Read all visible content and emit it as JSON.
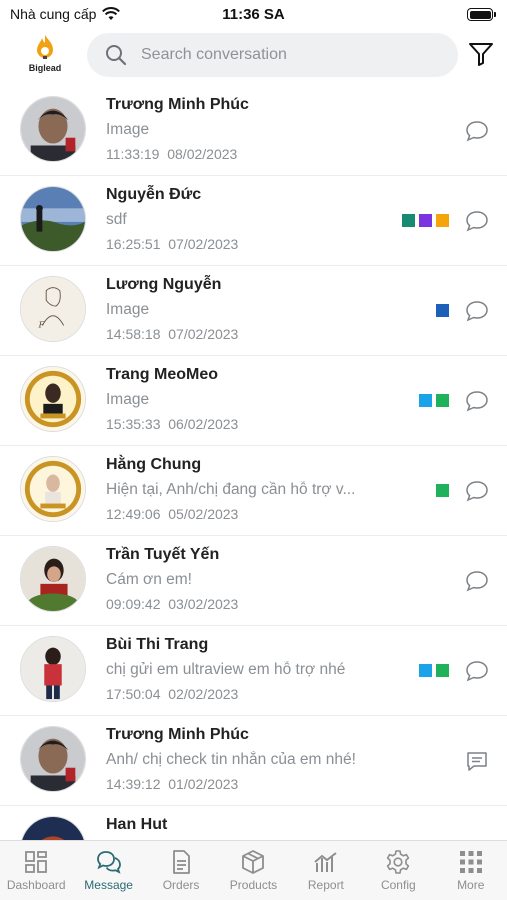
{
  "status_bar": {
    "carrier": "Nhà cung cấp",
    "time": "11:36 SA"
  },
  "header": {
    "logo_text": "Biglead",
    "search_placeholder": "Search conversation"
  },
  "colors": {
    "accent": "#2b6b73",
    "icon_gray": "#8e8e8e",
    "tag_green": "#20b25a",
    "tag_blue": "#1e5fb8",
    "tag_cyan": "#1aa3e8",
    "tag_teal": "#168a72",
    "tag_purple": "#7a35e0",
    "tag_orange": "#f5a40a"
  },
  "conversations": [
    {
      "name": "Trương Minh Phúc",
      "preview": "Image",
      "time": "11:33:19  08/02/2023",
      "tags": [],
      "icon": "chat-bubble-icon"
    },
    {
      "name": "Nguyễn Đức",
      "preview": "sdf",
      "time": "16:25:51  07/02/2023",
      "tags": [
        "#168a72",
        "#7a35e0",
        "#f5a40a"
      ],
      "icon": "chat-bubble-icon"
    },
    {
      "name": "Lương Nguyễn",
      "preview": "Image",
      "time": "14:58:18  07/02/2023",
      "tags": [
        "#1e5fb8"
      ],
      "icon": "chat-bubble-icon"
    },
    {
      "name": "Trang MeoMeo",
      "preview": "Image",
      "time": "15:35:33  06/02/2023",
      "tags": [
        "#1aa3e8",
        "#20b25a"
      ],
      "icon": "chat-bubble-icon"
    },
    {
      "name": "Hằng Chung",
      "preview": "Hiện tại, Anh/chị đang cần hỗ trợ v...",
      "time": "12:49:06  05/02/2023",
      "tags": [
        "#20b25a"
      ],
      "icon": "chat-bubble-icon"
    },
    {
      "name": "Trần Tuyết Yến",
      "preview": "Cám ơn em!",
      "time": "09:09:42  03/02/2023",
      "tags": [],
      "icon": "chat-bubble-icon"
    },
    {
      "name": "Bùi Thi Trang",
      "preview": "chị gửi em ultraview em hỗ trợ nhé",
      "time": "17:50:04  02/02/2023",
      "tags": [
        "#1aa3e8",
        "#20b25a"
      ],
      "icon": "chat-bubble-icon"
    },
    {
      "name": "Trương Minh Phúc",
      "preview": "Anh/ chị check tin nhắn của em nhé!",
      "time": "14:39:12  01/02/2023",
      "tags": [],
      "icon": "message-lines-icon"
    },
    {
      "name": "Han Hut",
      "preview": "",
      "time": "",
      "tags": [],
      "icon": ""
    }
  ],
  "tabs": [
    {
      "label": "Dashboard",
      "icon": "dashboard-icon",
      "active": false
    },
    {
      "label": "Message",
      "icon": "message-icon",
      "active": true
    },
    {
      "label": "Orders",
      "icon": "orders-icon",
      "active": false
    },
    {
      "label": "Products",
      "icon": "products-icon",
      "active": false
    },
    {
      "label": "Report",
      "icon": "report-icon",
      "active": false
    },
    {
      "label": "Config",
      "icon": "config-icon",
      "active": false
    },
    {
      "label": "More",
      "icon": "more-icon",
      "active": false
    }
  ]
}
